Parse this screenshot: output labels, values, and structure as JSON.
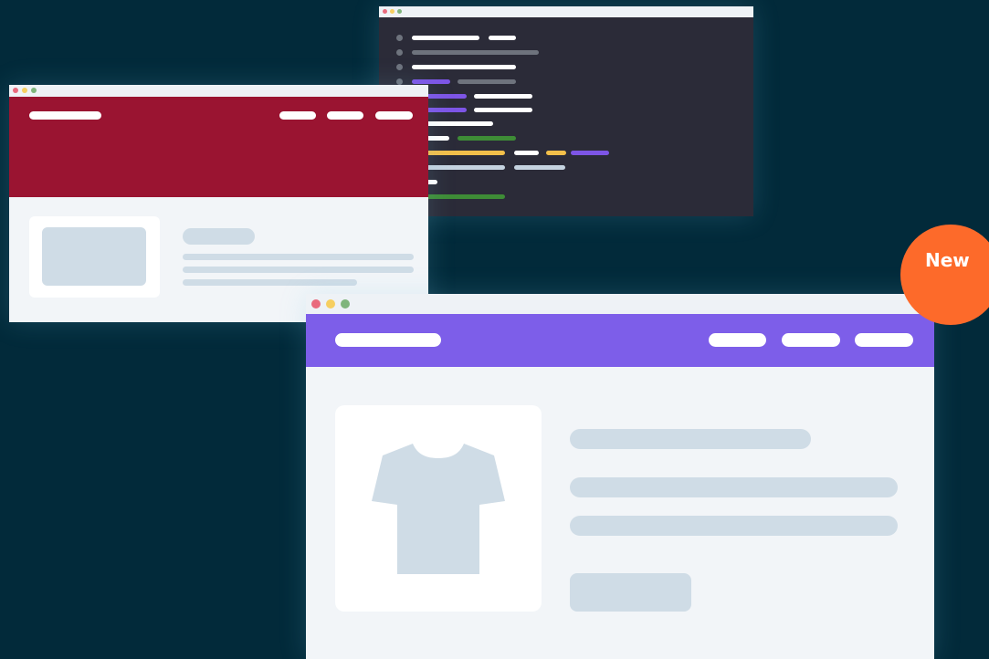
{
  "badge": {
    "label": "New",
    "color": "#fd6a2a"
  },
  "colors": {
    "background": "#022a3a",
    "red_header": "#9a1431",
    "purple_header": "#7d5ee9",
    "placeholder": "#cfdce6",
    "code_bg": "#2b2b38",
    "code_white": "#ffffff",
    "code_gray": "#6e737d",
    "code_purple": "#7d55e6",
    "code_green": "#3e8c36",
    "code_yellow": "#f2bf4a",
    "code_lightblue": "#c5d3e0",
    "dot_red": "#e96a7d",
    "dot_yellow": "#f6cf61",
    "dot_green": "#7fb57c"
  },
  "icons": {
    "product": "t-shirt-icon"
  }
}
